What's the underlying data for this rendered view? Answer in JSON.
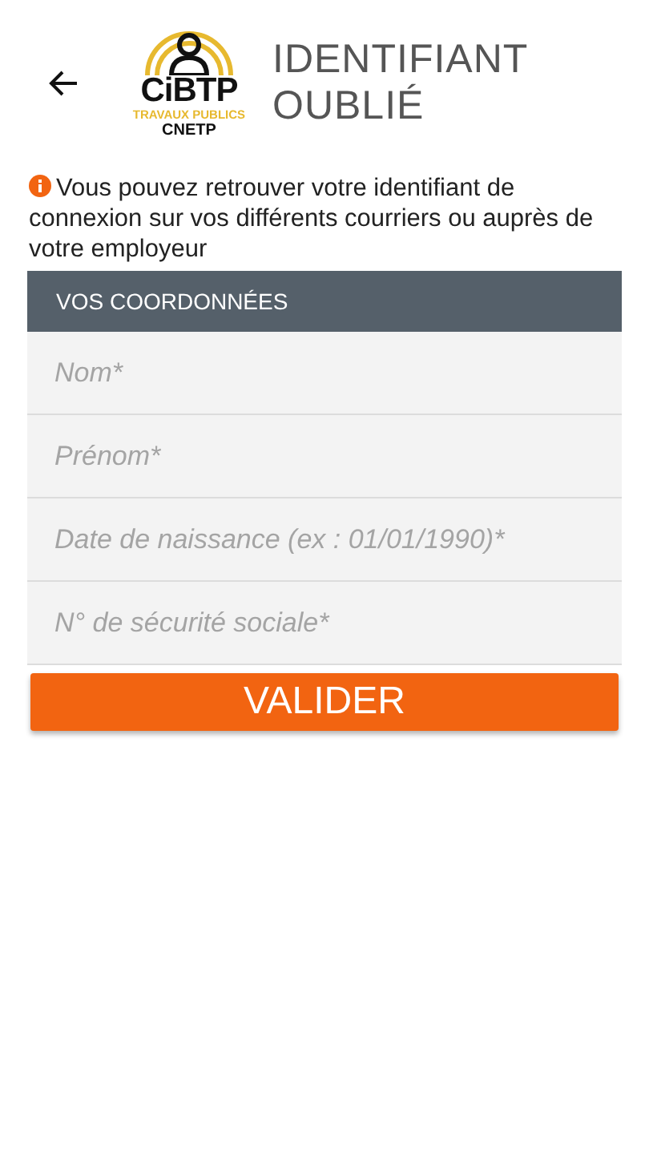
{
  "header": {
    "logo": {
      "name": "CiBTP",
      "subtitle": "TRAVAUX PUBLICS",
      "caption": "CNETP"
    },
    "title_lines": [
      "IDENTIFIANT",
      "OUBLIÉ"
    ]
  },
  "info": "Vous pouvez retrouver votre identifiant de connexion sur vos différents courriers ou auprès de votre employeur",
  "section": {
    "title": "VOS COORDONNÉES"
  },
  "fields": [
    {
      "placeholder": "Nom*"
    },
    {
      "placeholder": "Prénom*"
    },
    {
      "placeholder": "Date de naissance (ex : 01/01/1990)*"
    },
    {
      "placeholder": "N° de sécurité sociale*"
    }
  ],
  "buttons": [
    "VALIDER"
  ]
}
